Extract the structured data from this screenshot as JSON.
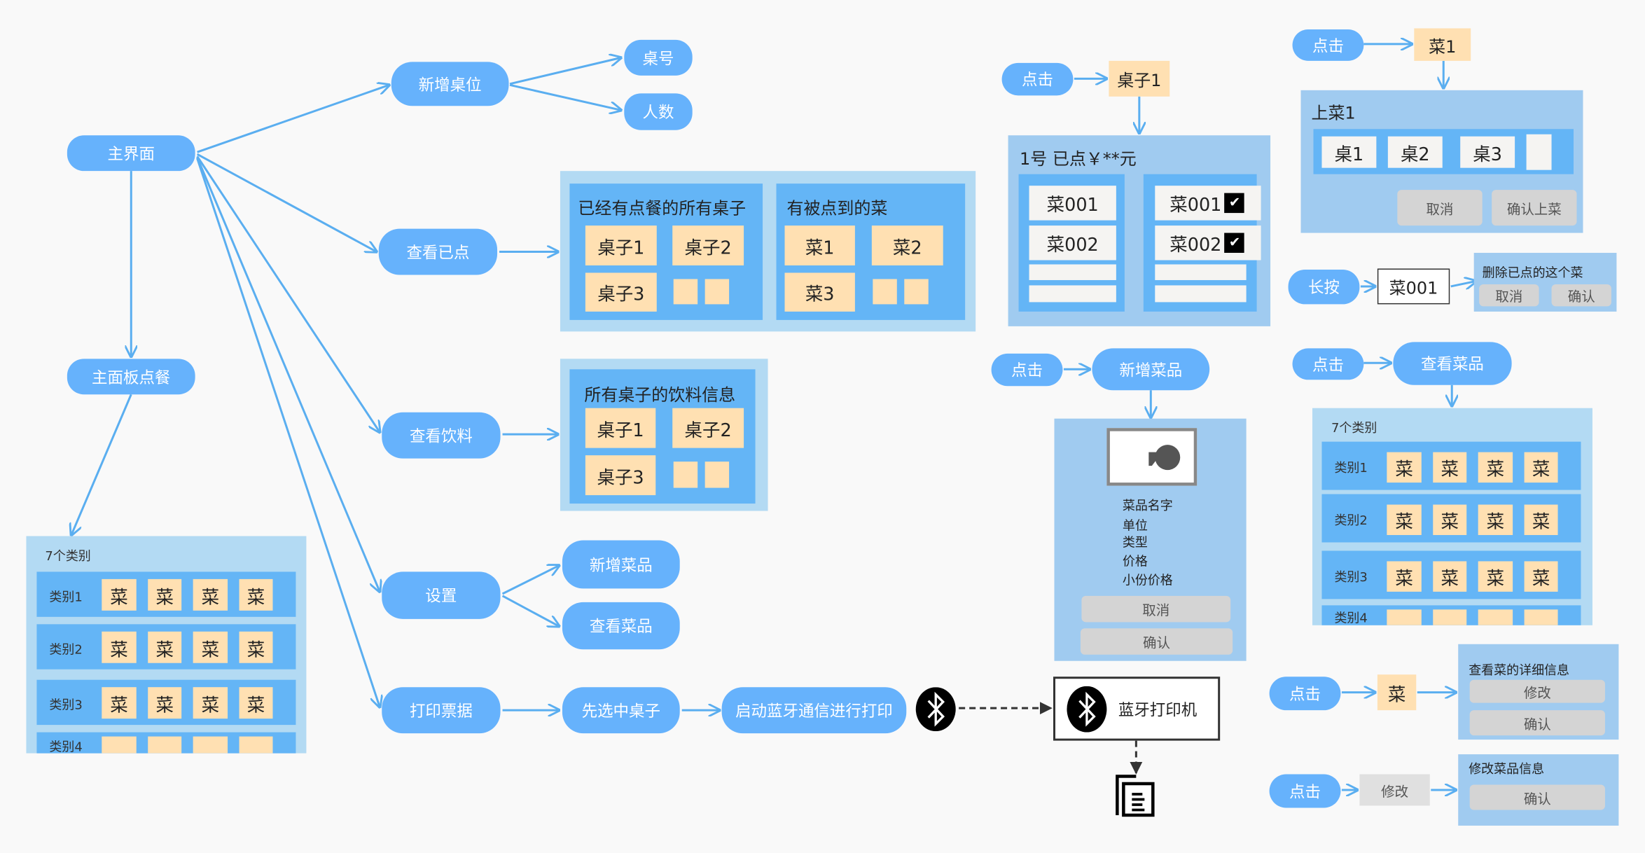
{
  "main": {
    "home": "主界面",
    "main_order": "主面板点餐",
    "add_table": "新增桌位",
    "table_no": "桌号",
    "people": "人数",
    "view_ordered": "查看已点",
    "view_drinks": "查看饮料",
    "settings": "设置",
    "add_dish": "新增菜品",
    "view_dish": "查看菜品",
    "print": "打印票据",
    "select_table": "先选中桌子",
    "bt_print": "启动蓝牙通信进行打印"
  },
  "ordered_panel": {
    "tables_title": "已经有点餐的所有桌子",
    "tables": [
      "桌子1",
      "桌子2",
      "桌子3"
    ],
    "dishes_title": "有被点到的菜",
    "dishes": [
      "菜1",
      "菜2",
      "菜3"
    ]
  },
  "drinks_panel": {
    "title": "所有桌子的饮料信息",
    "tables": [
      "桌子1",
      "桌子2",
      "桌子3"
    ]
  },
  "menu_left": {
    "count": "7个类别",
    "categories": [
      "类别1",
      "类别2",
      "类别3",
      "类别4"
    ],
    "dish": "菜"
  },
  "printer": {
    "label": "蓝牙打印机",
    "icon": "bluetooth-icon",
    "output_icon": "receipt-icon"
  },
  "table_detail": {
    "click": "点击",
    "table": "桌子1",
    "title": "1号 已点￥**元",
    "left_items": [
      "菜001",
      "菜002"
    ],
    "right_items": [
      "菜001",
      "菜002"
    ],
    "check": "✔"
  },
  "add_dish_flow": {
    "click": "点击",
    "title": "新增菜品",
    "fields": [
      "菜品名字",
      "单位",
      "类型",
      "价格",
      "小份价格"
    ],
    "cancel": "取消",
    "confirm": "确认"
  },
  "serve_flow": {
    "click": "点击",
    "dish": "菜1",
    "title": "上菜1",
    "tables": [
      "桌1",
      "桌2",
      "桌3"
    ],
    "cancel": "取消",
    "confirm": "确认上菜"
  },
  "delete_flow": {
    "long_press": "长按",
    "dish": "菜001",
    "title": "删除已点的这个菜",
    "cancel": "取消",
    "confirm": "确认"
  },
  "view_dish_flow": {
    "click": "点击",
    "title": "查看菜品",
    "count": "7个类别",
    "categories": [
      "类别1",
      "类别2",
      "类别3",
      "类别4"
    ],
    "dish": "菜"
  },
  "detail_flow": {
    "click": "点击",
    "dish": "菜",
    "title": "查看菜的详细信息",
    "edit": "修改",
    "confirm": "确认"
  },
  "edit_flow": {
    "click": "点击",
    "edit": "修改",
    "title": "修改菜品信息",
    "confirm": "确认"
  },
  "colors": {
    "node": "#66b2fc",
    "panel_light": "#a0cbf0",
    "panel_category": "#b3daf3",
    "panel_inner": "#64b5f6",
    "item": "#ffe0b2",
    "button": "#d4d4d4",
    "arrow": "#5aaef0"
  }
}
